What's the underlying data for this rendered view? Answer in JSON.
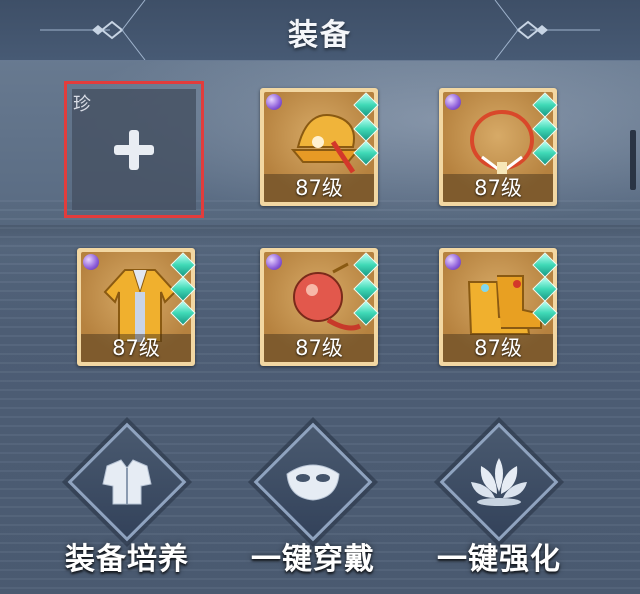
{
  "header": {
    "title": "装备"
  },
  "empty_slot": {
    "tag": "珍"
  },
  "equipment": [
    {
      "name": "helmet",
      "level_label": "87级",
      "gems": 3
    },
    {
      "name": "necklace",
      "level_label": "87级",
      "gems": 3
    },
    {
      "name": "robe",
      "level_label": "87级",
      "gems": 3
    },
    {
      "name": "pendant",
      "level_label": "87级",
      "gems": 3
    },
    {
      "name": "boots",
      "level_label": "87级",
      "gems": 3
    }
  ],
  "actions": [
    {
      "label": "装备培养",
      "icon": "clothing-icon"
    },
    {
      "label": "一键穿戴",
      "icon": "mask-icon"
    },
    {
      "label": "一键强化",
      "icon": "lotus-icon"
    }
  ],
  "colors": {
    "selection_border": "#e23c3c",
    "gem": "#3fd9b6",
    "quality_orb": "#8b5bd8",
    "slot_frame": "#f2d7a2"
  }
}
